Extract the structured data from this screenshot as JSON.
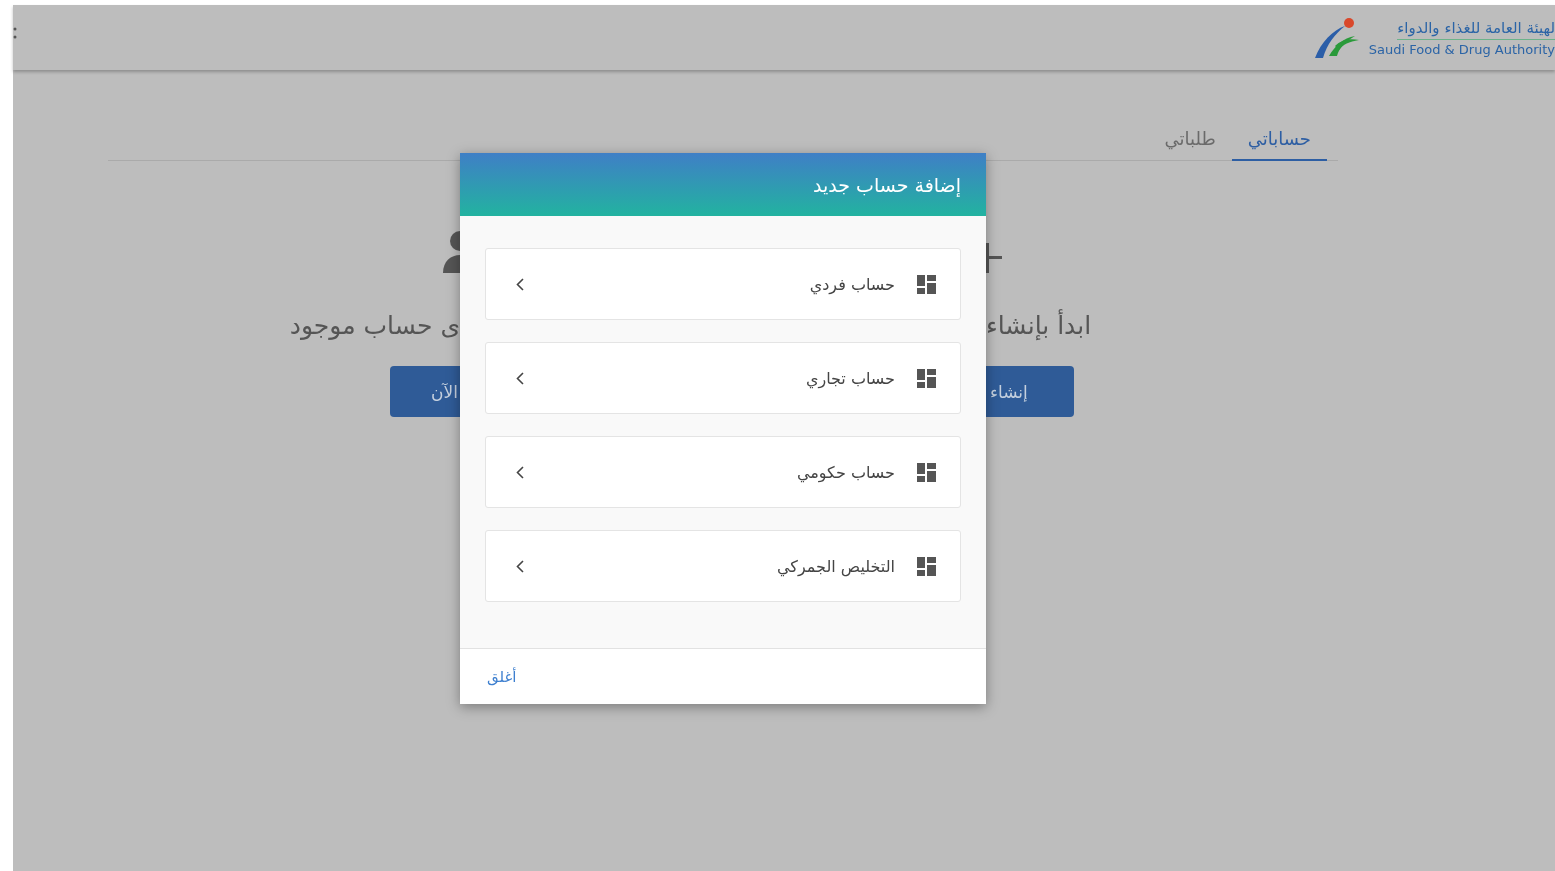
{
  "header": {
    "logo": {
      "arabic": "لهيئة العامة للغذاء والدواء",
      "english": "Saudi Food & Drug Authority"
    }
  },
  "tabs": [
    {
      "label": "حساباتي",
      "selected": true
    },
    {
      "label": "طلباتي",
      "selected": false
    }
  ],
  "empty_state": {
    "text_right": "ابدأ بإنشاء",
    "text_left": "ى حساب موجود",
    "button_right": "إنشاء",
    "button_left": "الآن"
  },
  "modal": {
    "title": "إضافة حساب جديد",
    "options": [
      {
        "label": "حساب فردي"
      },
      {
        "label": "حساب تجاري"
      },
      {
        "label": "حساب حكومي"
      },
      {
        "label": "التخليص الجمركي"
      }
    ],
    "close": "أغلق"
  }
}
